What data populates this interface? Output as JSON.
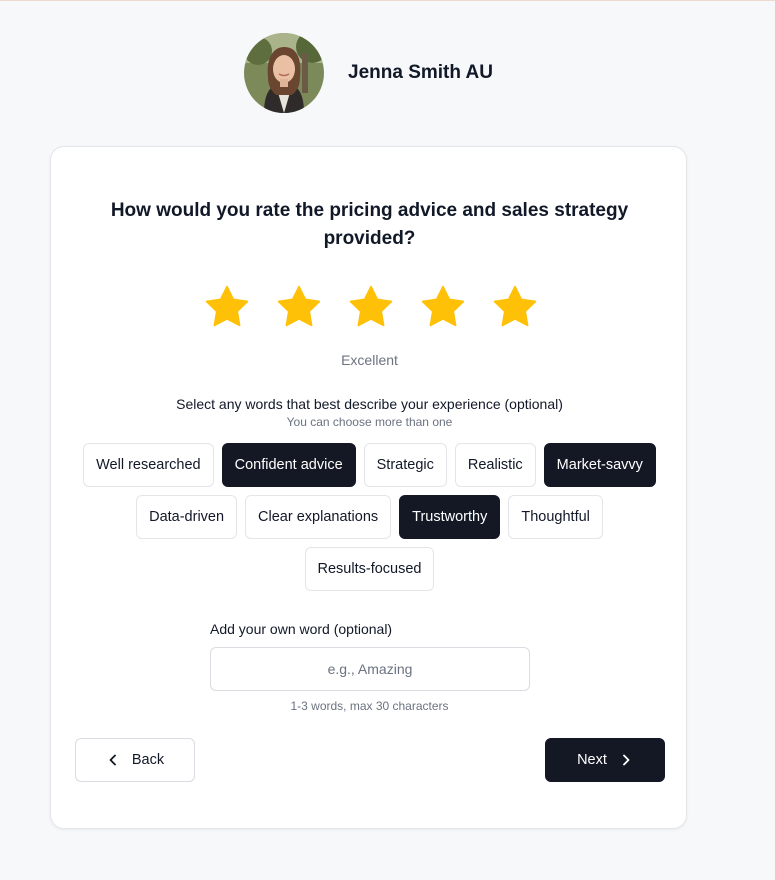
{
  "profile": {
    "name": "Jenna Smith AU"
  },
  "question": "How would you rate the pricing advice and sales strategy provided?",
  "rating": {
    "value": 5,
    "max": 5,
    "label": "Excellent",
    "star_color": "#FFC107"
  },
  "words": {
    "heading": "Select any words that best describe your experience (optional)",
    "subheading": "You can choose more than one",
    "options": [
      {
        "label": "Well researched",
        "selected": false
      },
      {
        "label": "Confident advice",
        "selected": true
      },
      {
        "label": "Strategic",
        "selected": false
      },
      {
        "label": "Realistic",
        "selected": false
      },
      {
        "label": "Market-savvy",
        "selected": true
      },
      {
        "label": "Data-driven",
        "selected": false
      },
      {
        "label": "Clear explanations",
        "selected": false
      },
      {
        "label": "Trustworthy",
        "selected": true
      },
      {
        "label": "Thoughtful",
        "selected": false
      },
      {
        "label": "Results-focused",
        "selected": false
      }
    ]
  },
  "own_word": {
    "label": "Add your own word (optional)",
    "placeholder": "e.g., Amazing",
    "value": "",
    "hint": "1-3 words, max 30 characters"
  },
  "nav": {
    "back_label": "Back",
    "next_label": "Next"
  },
  "colors": {
    "primary_dark": "#141824",
    "page_background": "#F7F8FA"
  }
}
